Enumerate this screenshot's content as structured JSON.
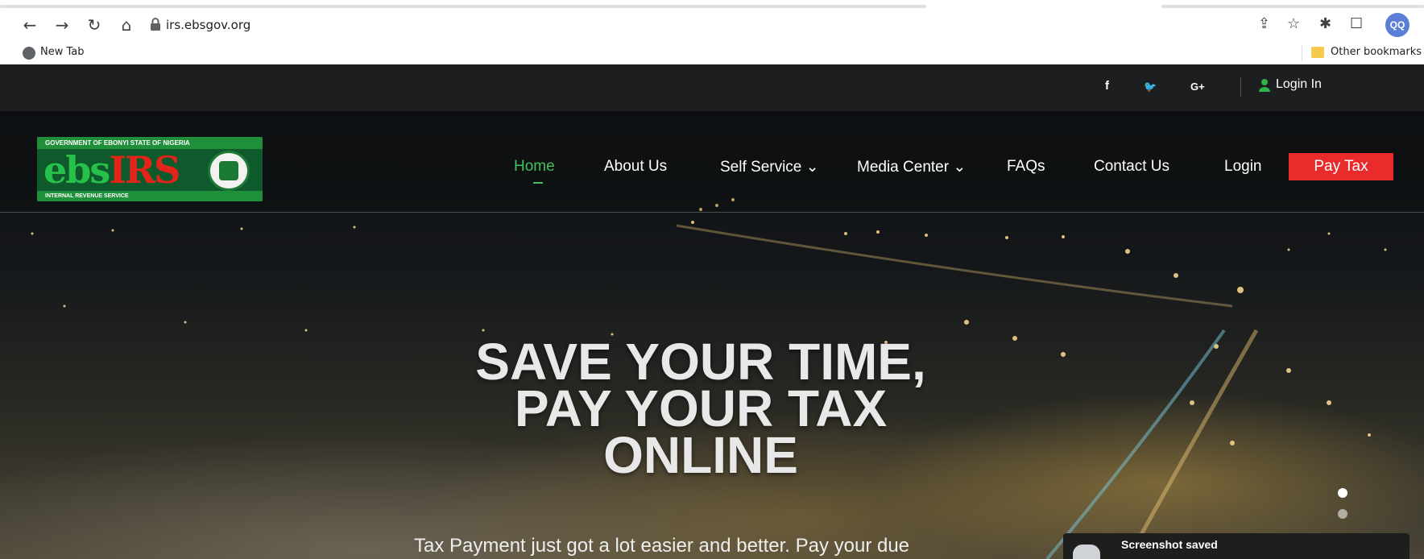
{
  "browser": {
    "url": "irs.ebsgov.org",
    "bookmark_new_tab": "New Tab",
    "bookmark_other": "Other bookmarks",
    "profile_initials": "QQ"
  },
  "topbar": {
    "social_facebook": "f",
    "social_twitter": "🐦",
    "social_google": "G+",
    "login_label": "Login In"
  },
  "logo": {
    "top_text": "GOVERNMENT OF EBONYI STATE OF NIGERIA",
    "word_green": "ebs",
    "word_red": "IRS",
    "bottom_text": "INTERNAL REVENUE SERVICE"
  },
  "nav": {
    "home": "Home",
    "about": "About Us",
    "self_service": "Self Service ⌄",
    "media_center": "Media Center ⌄",
    "faqs": "FAQs",
    "contact": "Contact Us",
    "login": "Login",
    "pay_tax": "Pay Tax"
  },
  "hero": {
    "line1": "SAVE YOUR TIME,",
    "line2": "PAY YOUR TAX",
    "line3": "ONLINE",
    "subtitle": "Tax Payment just got a lot easier and better. Pay your due"
  },
  "toast": {
    "title": "Screenshot saved"
  },
  "colors": {
    "accent_green": "#43c15b",
    "pay_tax_red": "#e92b2b"
  }
}
